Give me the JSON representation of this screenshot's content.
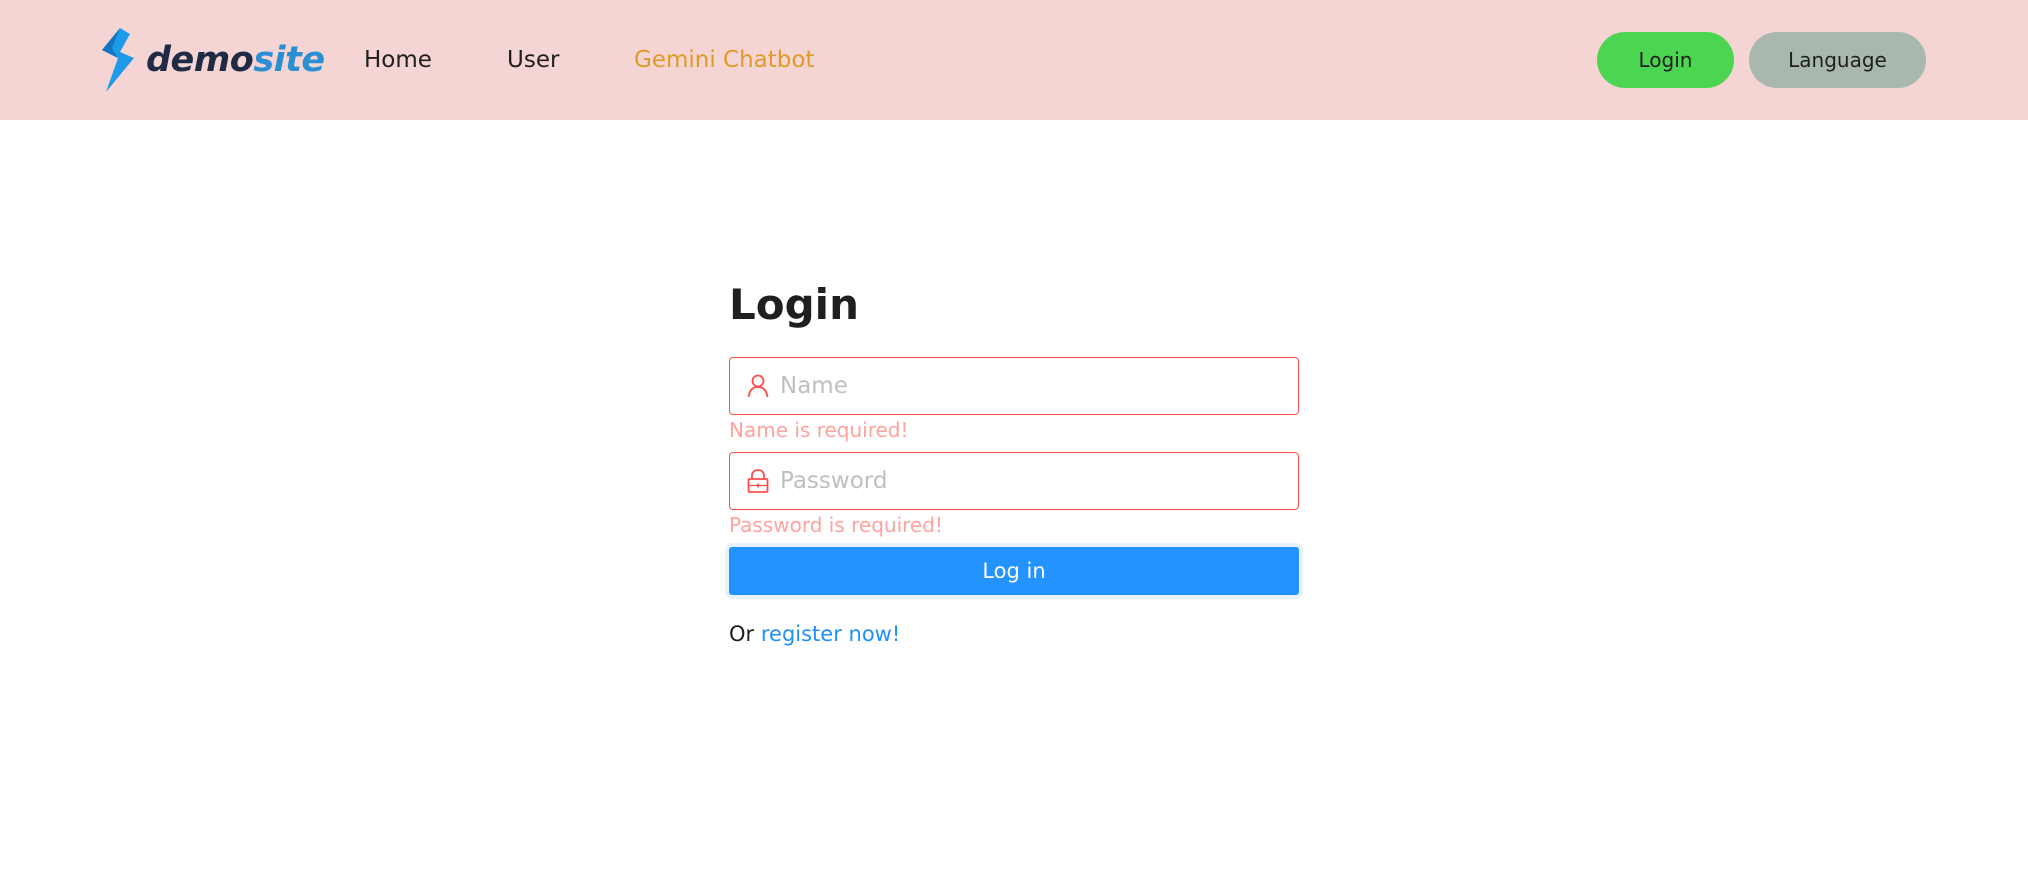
{
  "header": {
    "logo": {
      "word1": "demo",
      "word2": "site"
    },
    "nav": {
      "home": "Home",
      "user": "User",
      "gemini": "Gemini Chatbot"
    },
    "login_button": "Login",
    "language_button": "Language"
  },
  "form": {
    "title": "Login",
    "name_placeholder": "Name",
    "name_error": "Name is required!",
    "password_placeholder": "Password",
    "password_error": "Password is required!",
    "submit_label": "Log in",
    "register_prefix": "Or",
    "register_link": "register now!"
  },
  "icons": {
    "logo": "lightning-bolt-icon",
    "name_field": "user-icon",
    "password_field": "lock-icon"
  },
  "colors": {
    "header_bg": "#f5d5d3",
    "login_button_bg": "#4cd550",
    "language_button_bg": "#a9b8ae",
    "gemini_link": "#e09a2a",
    "primary": "#2394ff",
    "error_border": "#ff4d4f",
    "error_text": "#ffa39e",
    "link": "#1f8fff"
  }
}
